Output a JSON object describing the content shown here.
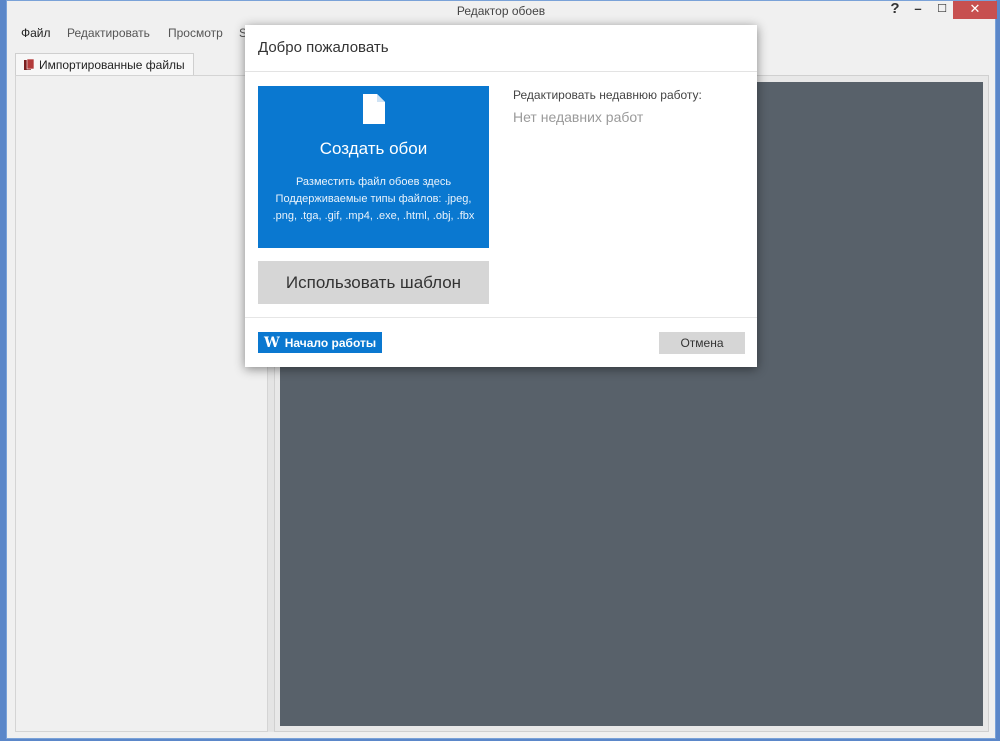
{
  "window": {
    "title": "Редактор обоев",
    "help_label": "?",
    "min_label": "–",
    "max_label": "☐",
    "close_label": "✕"
  },
  "menu": {
    "items": [
      {
        "label": "Файл"
      },
      {
        "label": "Редактировать"
      },
      {
        "label": "Просмотр"
      },
      {
        "label": "S"
      }
    ]
  },
  "tabs": [
    {
      "label": "Импортированные файлы",
      "icon": "files-icon"
    }
  ],
  "dialog": {
    "title": "Добро пожаловать",
    "create": {
      "icon": "file-icon",
      "title": "Создать обои",
      "line1": "Разместить файл обоев здесь",
      "line2": "Поддерживаемые типы файлов: .jpeg, .png, .tga, .gif, .mp4, .exe, .html, .obj, .fbx"
    },
    "template_label": "Использовать шаблон",
    "recent_label": "Редактировать недавнюю работу:",
    "recent_empty": "Нет недавних работ",
    "start_label": "Начало работы",
    "start_icon_text": "W",
    "cancel_label": "Отмена"
  },
  "colors": {
    "accent": "#0a78d0",
    "canvas": "#58616a",
    "close": "#c75050"
  }
}
